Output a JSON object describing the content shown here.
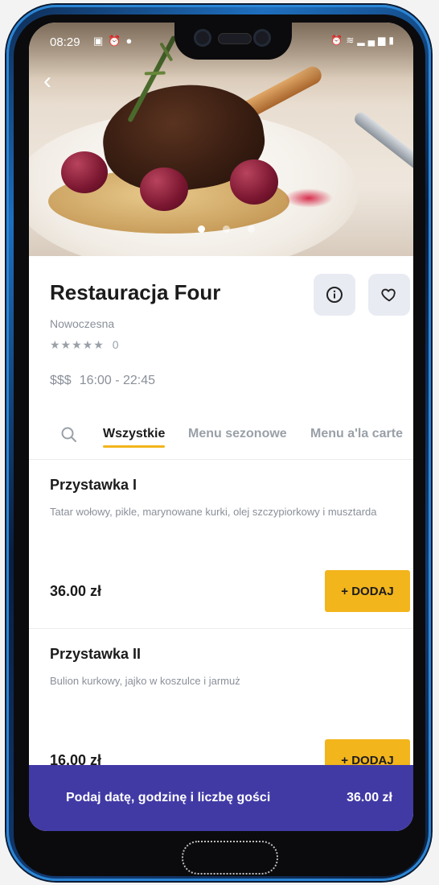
{
  "status_bar": {
    "time": "08:29",
    "left_icons": [
      "image-icon",
      "alarm-icon",
      "message-icon"
    ],
    "right_icons": [
      "alarm-icon",
      "wifi-icon",
      "volte-icon",
      "signal-icon",
      "battery-icon"
    ],
    "network": "Vo8 LTE2"
  },
  "hero": {
    "image": "plated-duck-leg-with-risotto-and-beets",
    "slides": 3,
    "active_slide": 1
  },
  "restaurant": {
    "name": "Restauracja Four",
    "category": "Nowoczesna",
    "stars": "★★★★★",
    "rating_count": "0",
    "price_level": "$$$",
    "hours": "16:00 - 22:45"
  },
  "tabs": [
    {
      "label": "Wszystkie",
      "active": true
    },
    {
      "label": "Menu sezonowe",
      "active": false
    },
    {
      "label": "Menu a'la carte",
      "active": false
    }
  ],
  "menu_items": [
    {
      "name": "Przystawka I",
      "description": "Tatar wołowy, pikle, marynowane kurki, olej szczypiorkowy i musztarda",
      "price": "36.00 zł",
      "add_label": "+ DODAJ"
    },
    {
      "name": "Przystawka II",
      "description": "Bulion kurkowy, jajko w koszulce i jarmuż",
      "price": "16.00 zł",
      "add_label": "+ DODAJ"
    }
  ],
  "booking_bar": {
    "label": "Podaj datę, godzinę i liczbę gości",
    "total": "36.00 zł"
  },
  "colors": {
    "accent": "#f2b51c",
    "booking_bar": "#413aa5",
    "muted_text": "#8a8f99",
    "icon_button_bg": "#e9ebf3"
  }
}
